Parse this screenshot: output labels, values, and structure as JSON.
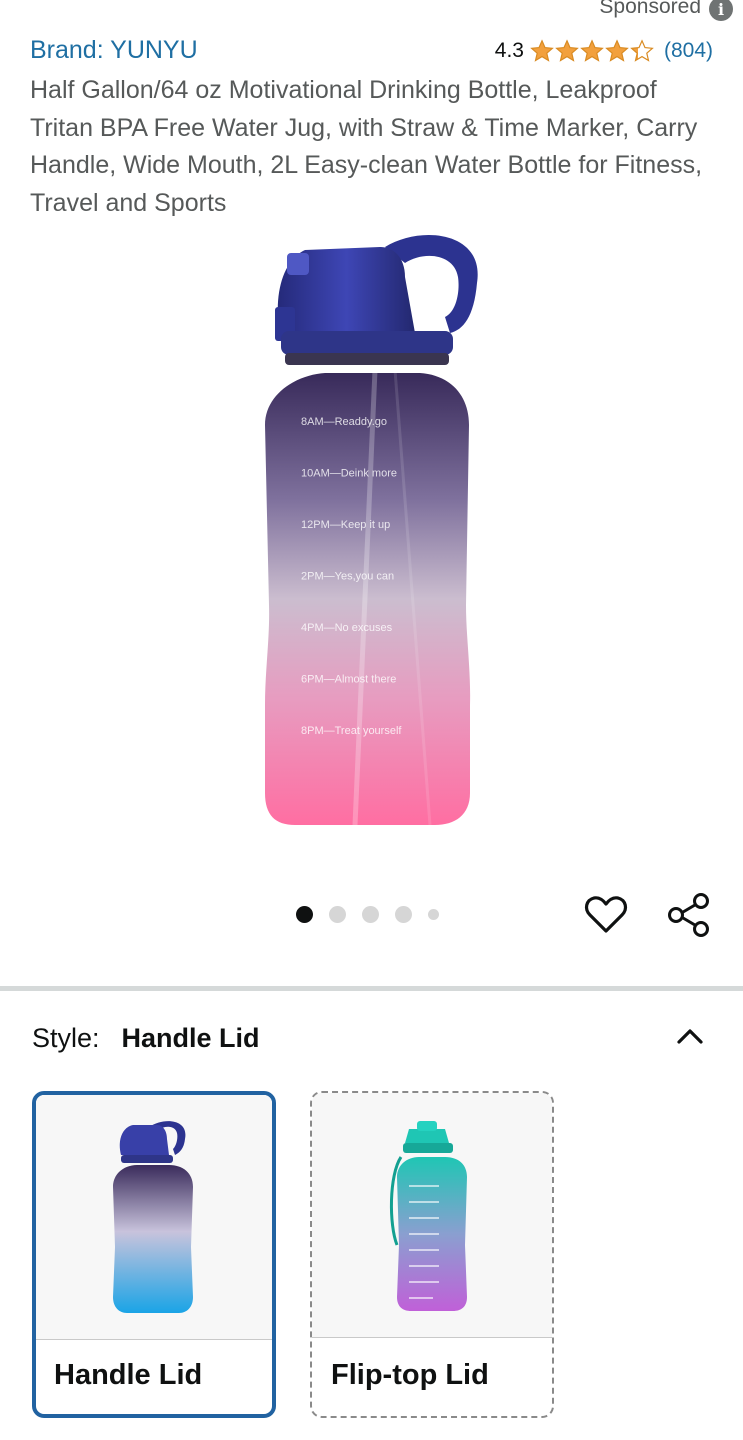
{
  "sponsored": {
    "label": "Sponsored",
    "icon": "info-icon"
  },
  "product": {
    "brand": "Brand: YUNYU",
    "rating": "4.3",
    "rating_value": 4.3,
    "rating_max": 5,
    "review_count": "(804)",
    "title": "Half Gallon/64 oz Motivational Drinking Bottle, Leakproof Tritan BPA Free Water Jug, with Straw & Time Marker, Carry Handle, Wide Mouth, 2L Easy-clean Water Bottle for Fitness, Travel and Sports",
    "bottle_markers": [
      "8AM—Readdy.go",
      "10AM—Deink more",
      "12PM—Keep it up",
      "2PM—Yes,you can",
      "4PM—No excuses",
      "6PM—Almost there",
      "8PM—Treat yourself"
    ]
  },
  "gallery": {
    "image_count": 5,
    "active_index": 0
  },
  "actions": {
    "favorite_icon": "heart-icon",
    "share_icon": "share-icon"
  },
  "style_selector": {
    "label": "Style:",
    "selected": "Handle Lid",
    "collapse_icon": "chevron-up-icon",
    "options": [
      {
        "name": "Handle Lid",
        "selected": true
      },
      {
        "name": "Flip-top Lid",
        "selected": false
      }
    ]
  },
  "colors": {
    "link": "#1f6fa3",
    "star": "#f2a03d",
    "selected_border": "#2162a1",
    "bottle_top": "#3a2a5c",
    "bottle_bottom": "#ff6fa4"
  }
}
